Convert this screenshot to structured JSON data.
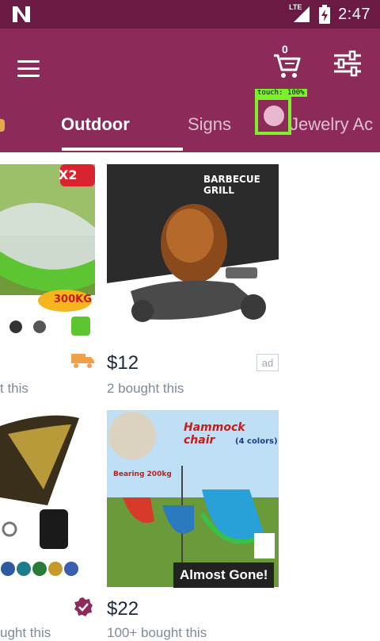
{
  "status_bar": {
    "time": "2:47",
    "network": "LTE"
  },
  "header": {
    "cart_count": "0"
  },
  "tabs": [
    {
      "label": "Outdoor",
      "active": true
    },
    {
      "label": "Signs",
      "active": false
    },
    {
      "label": "Jewelry Ac",
      "active": false
    }
  ],
  "touch_indicator": {
    "label": "touch: 100%"
  },
  "products": [
    {
      "id": "hammock-net",
      "image_text": "300KG",
      "badge": "X2"
    },
    {
      "id": "bbq-grill",
      "image_title": "BARBECUE GRILL",
      "price": "$12",
      "bought": "2 bought this",
      "ad": "ad"
    },
    {
      "id": "hammock-bag",
      "bought_partial": "ught this"
    },
    {
      "id": "hammock-chair",
      "image_title": "Hammock chair",
      "image_sub": "(4 colors)",
      "image_note": "Bearing 200kg",
      "price": "$22",
      "bought": "100+ bought this",
      "tag": "Almost Gone!"
    }
  ],
  "left_col": {
    "bought_top": "t this"
  },
  "colors": {
    "status": "#6b1a43",
    "header": "#8c2a5a",
    "touch": "#7cf02a"
  }
}
